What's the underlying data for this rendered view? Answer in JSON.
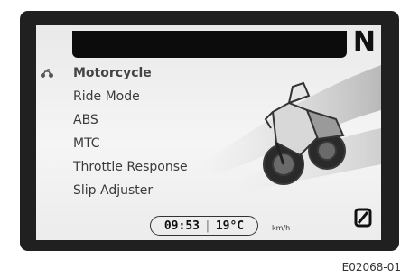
{
  "header": {
    "gear_indicator": "N"
  },
  "menu": {
    "items": [
      {
        "label": "Motorcycle",
        "icon": "motorcycle-icon",
        "selected": true
      },
      {
        "label": "Ride Mode"
      },
      {
        "label": "ABS"
      },
      {
        "label": "MTC"
      },
      {
        "label": "Throttle Response"
      },
      {
        "label": "Slip Adjuster"
      }
    ]
  },
  "status_bar": {
    "time": "09:53",
    "temperature": "19°C",
    "speed_unit": "km/h"
  },
  "icons": {
    "bottom_right": "zero-reset-icon"
  },
  "figure_ref": "E02068-01"
}
